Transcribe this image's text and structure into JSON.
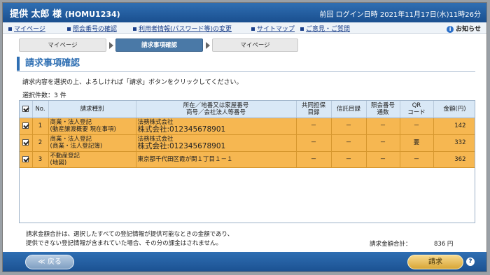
{
  "header": {
    "user_name": "提供 太郎 様",
    "user_id": "(HOMU1234)",
    "login_info": "前回 ログイン日時 2021年11月17日(水)11時26分"
  },
  "menu": {
    "items": [
      {
        "label": "マイページ"
      },
      {
        "label": "照会番号の確認"
      },
      {
        "label": "利用者情報(パスワード等)の変更"
      },
      {
        "label": "サイトマップ"
      },
      {
        "label": "ご意見・ご質問"
      }
    ],
    "notice_label": "お知らせ"
  },
  "steps": [
    {
      "label": "マイページ",
      "active": false
    },
    {
      "label": "請求事項確認",
      "active": true
    },
    {
      "label": "マイページ",
      "active": false
    }
  ],
  "page_title": "請求事項確認",
  "instruction": "請求内容を選択の上、よろしければ「請求」ボタンをクリックしてください。",
  "selection_count": "選択件数：3 件",
  "table": {
    "headers": {
      "no": "No.",
      "type": "請求種別",
      "address_1": "所在／地番又は家屋番号",
      "address_2": "商号／会社法人等番号",
      "collateral_1": "共同担保",
      "collateral_2": "目録",
      "trust": "信託目録",
      "ref_1": "照会番号",
      "ref_2": "通数",
      "qr_1": "QR",
      "qr_2": "コード",
      "amount": "金額(円)"
    },
    "rows": [
      {
        "no": "1",
        "type_1": "商業・法人登記",
        "type_2": "(動産譲渡概要 現在事項)",
        "addr_1": "法務株式会社",
        "addr_2": "株式会社:012345678901",
        "collateral": "－",
        "trust": "－",
        "ref": "－",
        "qr": "－",
        "amount": "142"
      },
      {
        "no": "2",
        "type_1": "商業・法人登記",
        "type_2": "(商業・法人登記簿)",
        "addr_1": "法務株式会社",
        "addr_2": "株式会社:012345678901",
        "collateral": "－",
        "trust": "－",
        "ref": "－",
        "qr": "要",
        "amount": "332"
      },
      {
        "no": "3",
        "type_1": "不動産登記",
        "type_2": "(地図)",
        "addr_1": "東京都千代田区霞が関１丁目１－１",
        "addr_2": "",
        "collateral": "－",
        "trust": "－",
        "ref": "－",
        "qr": "－",
        "amount": "362"
      }
    ]
  },
  "note": {
    "line1": "請求金額合計は、選択したすべての登記情報が提供可能なときの金額であり、",
    "line2": "提供できない登記情報が含まれていた場合、その分の課金はされません。"
  },
  "total": {
    "label": "請求金額合計：",
    "value": "836 円"
  },
  "footer": {
    "back_label": "≪ 戻る",
    "submit_label": "請求",
    "help_label": "?"
  },
  "colors": {
    "header_blue": "#1a4f8f",
    "row_orange": "#f6b751",
    "table_header": "#d9e8f6",
    "submit_gold": "#d8a637"
  }
}
